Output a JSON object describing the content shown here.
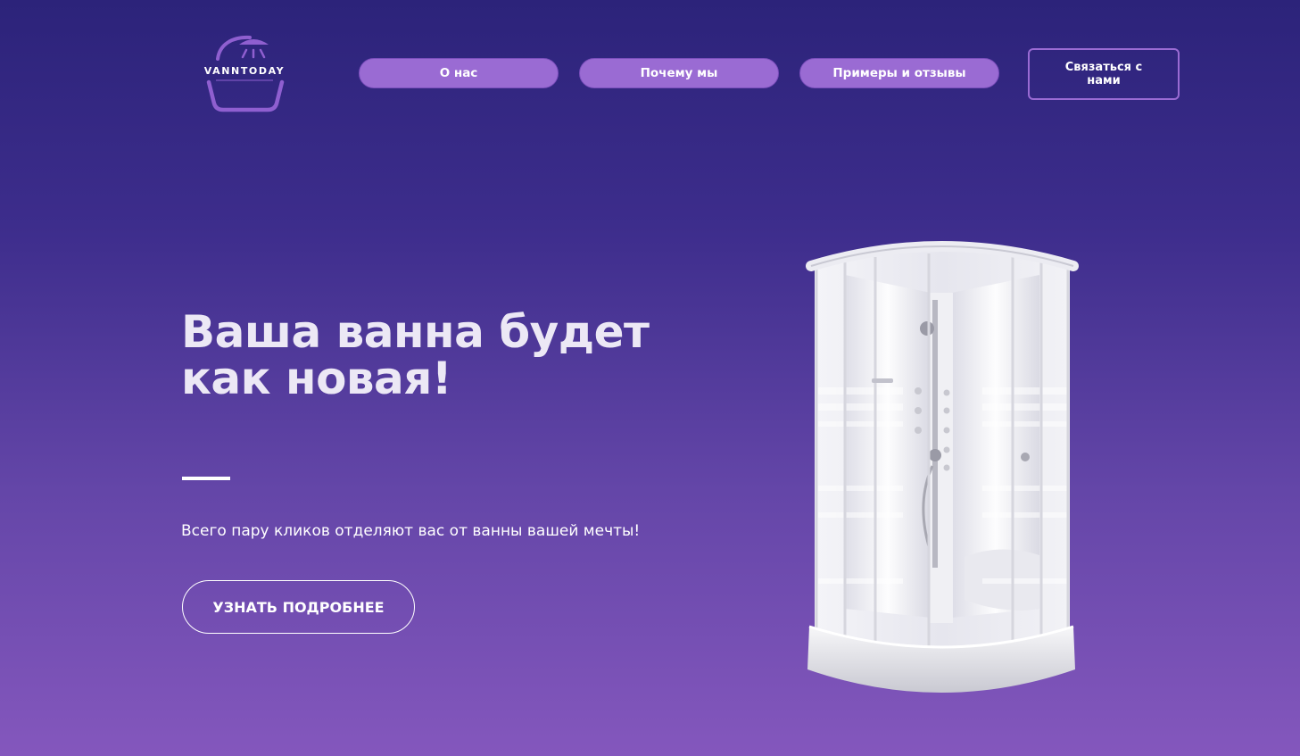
{
  "brand": {
    "name": "VANNTODAY"
  },
  "nav": {
    "items": [
      {
        "label": "О нас"
      },
      {
        "label": "Почему мы"
      },
      {
        "label": "Примеры и отзывы"
      }
    ],
    "contact_label": "Связаться с нами"
  },
  "hero": {
    "title": "Ваша ванна будет как новая!",
    "subtitle": "Всего пару кликов отделяют вас от ванны вашей мечты!",
    "cta_label": "УЗНАТЬ ПОДРОБНЕЕ"
  },
  "images": {
    "product": "shower-cabin-image",
    "logo": "bathtub-shower-logo"
  },
  "colors": {
    "background_top": "#2c237a",
    "background_bottom": "#8457bd",
    "accent": "#9a6bd3"
  }
}
